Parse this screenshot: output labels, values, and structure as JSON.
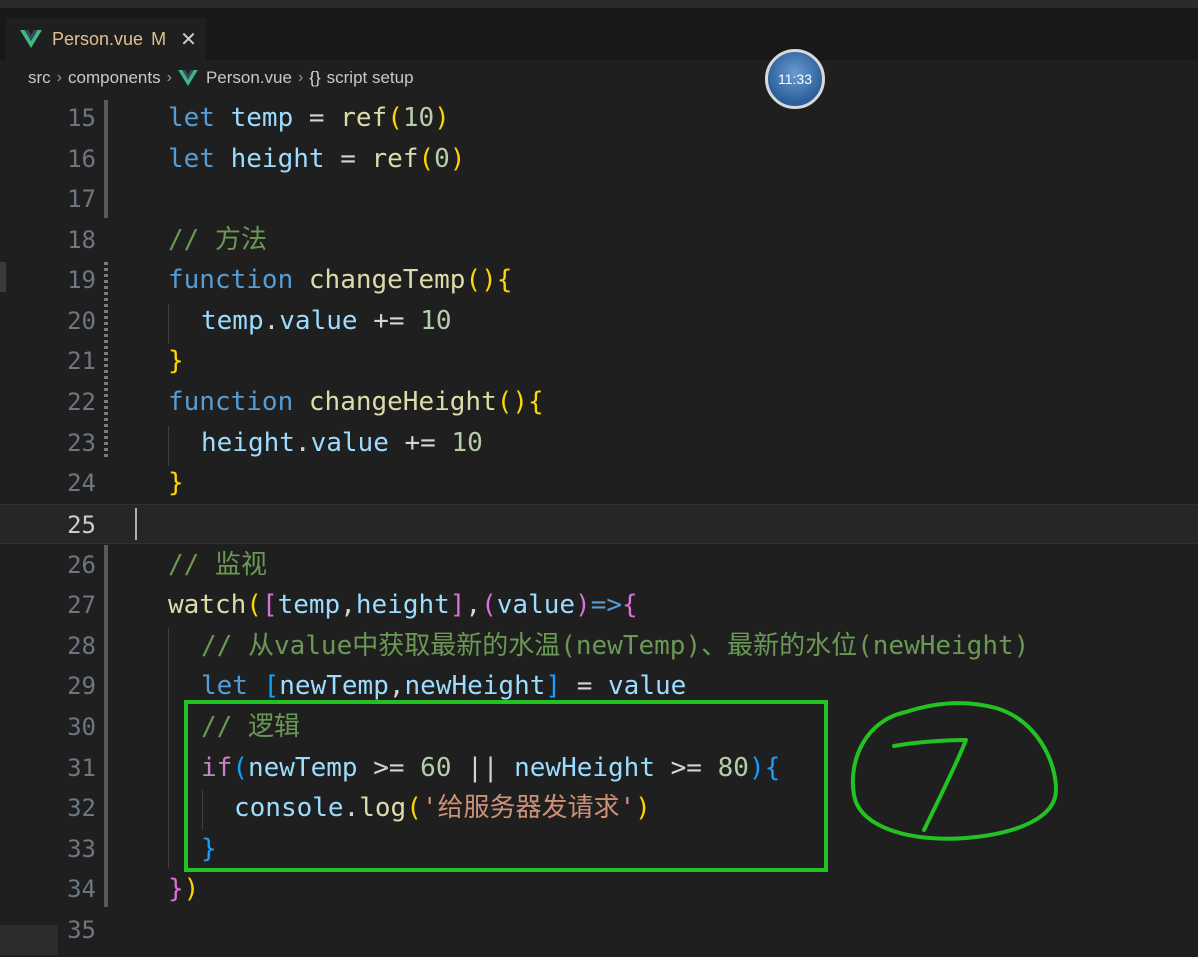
{
  "tab": {
    "label": "Person.vue",
    "modified": "M",
    "close": "✕"
  },
  "breadcrumb": {
    "part1": "src",
    "part2": "components",
    "part3": "Person.vue",
    "part4": "{}",
    "part5": "script setup"
  },
  "overlay": {
    "clock_time": "11:33"
  },
  "editor": {
    "current_line": "25",
    "lines": [
      {
        "n": "15"
      },
      {
        "n": "16"
      },
      {
        "n": "17"
      },
      {
        "n": "18"
      },
      {
        "n": "19"
      },
      {
        "n": "20"
      },
      {
        "n": "21"
      },
      {
        "n": "22"
      },
      {
        "n": "23"
      },
      {
        "n": "24"
      },
      {
        "n": "25"
      },
      {
        "n": "26"
      },
      {
        "n": "27"
      },
      {
        "n": "28"
      },
      {
        "n": "29"
      },
      {
        "n": "30"
      },
      {
        "n": "31"
      },
      {
        "n": "32"
      },
      {
        "n": "33"
      },
      {
        "n": "34"
      },
      {
        "n": "35"
      }
    ],
    "code": {
      "l15": {
        "kw": "let",
        "var": "temp",
        "op": " = ",
        "fn": "ref",
        "num": "10"
      },
      "l16": {
        "kw": "let",
        "var": "height",
        "op": " = ",
        "fn": "ref",
        "num": "0"
      },
      "l18": {
        "comment": "// 方法"
      },
      "l19": {
        "kw": "function",
        "fn": "changeTemp"
      },
      "l20": {
        "var": "temp",
        "prop": "value",
        "op": " += ",
        "num": "10"
      },
      "l22": {
        "kw": "function",
        "fn": "changeHeight"
      },
      "l23": {
        "var": "height",
        "prop": "value",
        "op": " += ",
        "num": "10"
      },
      "l26": {
        "comment": "// 监视"
      },
      "l27": {
        "fn": "watch",
        "a": "temp",
        "b": "height",
        "c": "value"
      },
      "l28": {
        "comment": "// 从value中获取最新的水温(newTemp)、最新的水位(newHeight)"
      },
      "l29": {
        "kw": "let",
        "a": "newTemp",
        "b": "newHeight",
        "op": " = ",
        "c": "value"
      },
      "l30": {
        "comment": "// 逻辑"
      },
      "l31": {
        "kw": "if",
        "a": "newTemp",
        "op1": " >= ",
        "n1": "60",
        "op2": " || ",
        "b": "newHeight",
        "op3": " >= ",
        "n2": "80"
      },
      "l32": {
        "obj": "console",
        "fn": "log",
        "str": "'给服务器发请求'"
      }
    }
  },
  "annotation": {
    "handwritten": "7",
    "box_color": "#22c222"
  },
  "colors": {
    "keyword": "#569cd6",
    "control": "#c586c0",
    "variable": "#9cdcfe",
    "function": "#dcdcaa",
    "number": "#b5cea8",
    "string": "#ce9178",
    "comment": "#6a9955",
    "background": "#1f1f1f"
  }
}
